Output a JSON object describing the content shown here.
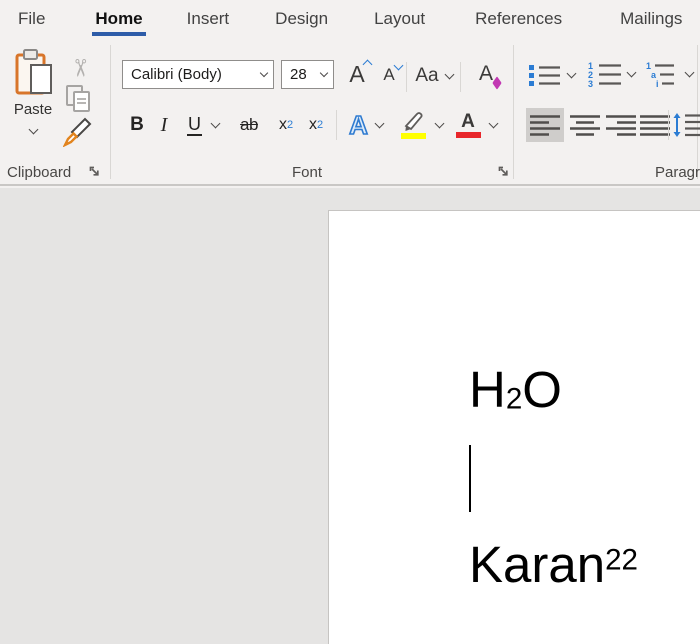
{
  "menubar": {
    "tabs": [
      {
        "label": "File"
      },
      {
        "label": "Home",
        "active": true
      },
      {
        "label": "Insert"
      },
      {
        "label": "Design"
      },
      {
        "label": "Layout"
      },
      {
        "label": "References"
      },
      {
        "label": "Mailings"
      }
    ]
  },
  "ribbon": {
    "clipboard": {
      "group_label": "Clipboard",
      "paste_label": "Paste"
    },
    "font": {
      "group_label": "Font",
      "font_name_value": "Calibri (Body)",
      "font_size_value": "28",
      "grow_font_glyph": "A",
      "shrink_font_glyph": "A",
      "change_case_glyph": "Aa",
      "clear_formatting_glyph": "A",
      "bold_glyph": "B",
      "italic_glyph": "I",
      "underline_glyph": "U",
      "strikethrough_glyph": "ab",
      "subscript_base": "x",
      "subscript_mark": "2",
      "superscript_base": "x",
      "superscript_mark": "2",
      "text_effects_glyph": "A",
      "font_color_glyph": "A"
    },
    "paragraph": {
      "group_label": "Paragraph"
    }
  },
  "document": {
    "line1": {
      "base1": "H",
      "subscript": "2",
      "base2": "O"
    },
    "line2": {
      "base": "Karan",
      "superscript": "22"
    }
  },
  "icons": {
    "scissors": "✂"
  },
  "colors": {
    "accent_blue": "#2d5ca8",
    "icon_blue": "#2b7cd3",
    "highlight_yellow": "#ffff00",
    "font_color_red": "#e8262b",
    "clipboard_orange": "#d8752a",
    "eraser_magenta": "#c239b3",
    "selected_button_gray": "#cfcdcb",
    "canvas_background": "#e5e4e3",
    "page_background": "#ffffff"
  }
}
